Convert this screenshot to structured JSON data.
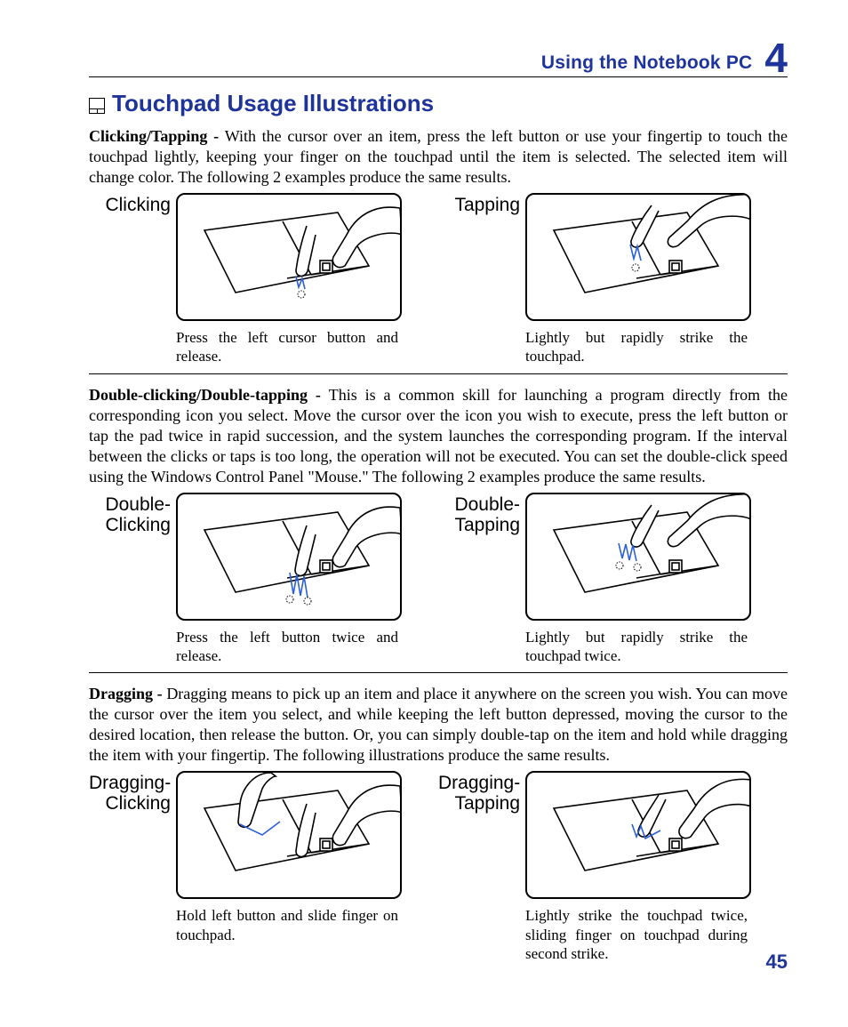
{
  "header": {
    "title": "Using the Notebook PC",
    "chapter": "4"
  },
  "page_number": "45",
  "heading": "Touchpad Usage Illustrations",
  "sections": {
    "click": {
      "intro_bold": "Clicking/Tapping - ",
      "intro_rest": "With the cursor over an item, press the left button or use your fingertip to touch the touchpad lightly, keeping your finger on the touchpad until the item is selected. The selected item will change color. The following 2 examples produce the same results.",
      "left_label": "Clicking",
      "right_label": "Tapping",
      "left_caption": "Press the left cursor button and release.",
      "right_caption": "Lightly but rapidly strike the touchpad."
    },
    "double": {
      "intro_bold": "Double-clicking/Double-tapping - ",
      "intro_rest": "This is a common skill for launching a program directly from the corresponding icon you select. Move the cursor over the icon you wish to execute, press the left button or tap the pad twice in rapid succession, and the system launches the corresponding program. If the interval between the clicks or taps is too long, the operation will not be executed. You can set the double-click speed using the Windows Control Panel \"Mouse.\" The following 2 examples produce the same results.",
      "left_label": "Double-Clicking",
      "right_label": "Double-Tapping",
      "left_caption": "Press the left button twice and release.",
      "right_caption": "Lightly but rapidly strike the touchpad twice."
    },
    "drag": {
      "intro_bold": "Dragging - ",
      "intro_rest": "Dragging means to pick up an item and place it anywhere on the screen you wish. You can move the cursor over the item you select, and while keeping the left button depressed, moving the cursor to the desired location, then release the button. Or, you can simply double-tap on the item and hold while dragging the item with your fingertip. The following illustrations produce the same results.",
      "left_label": "Dragging-Clicking",
      "right_label": "Dragging-Tapping",
      "left_caption": "Hold left button and slide finger on touchpad.",
      "right_caption": "Lightly strike the touchpad twice, sliding finger on touchpad during second strike."
    }
  }
}
